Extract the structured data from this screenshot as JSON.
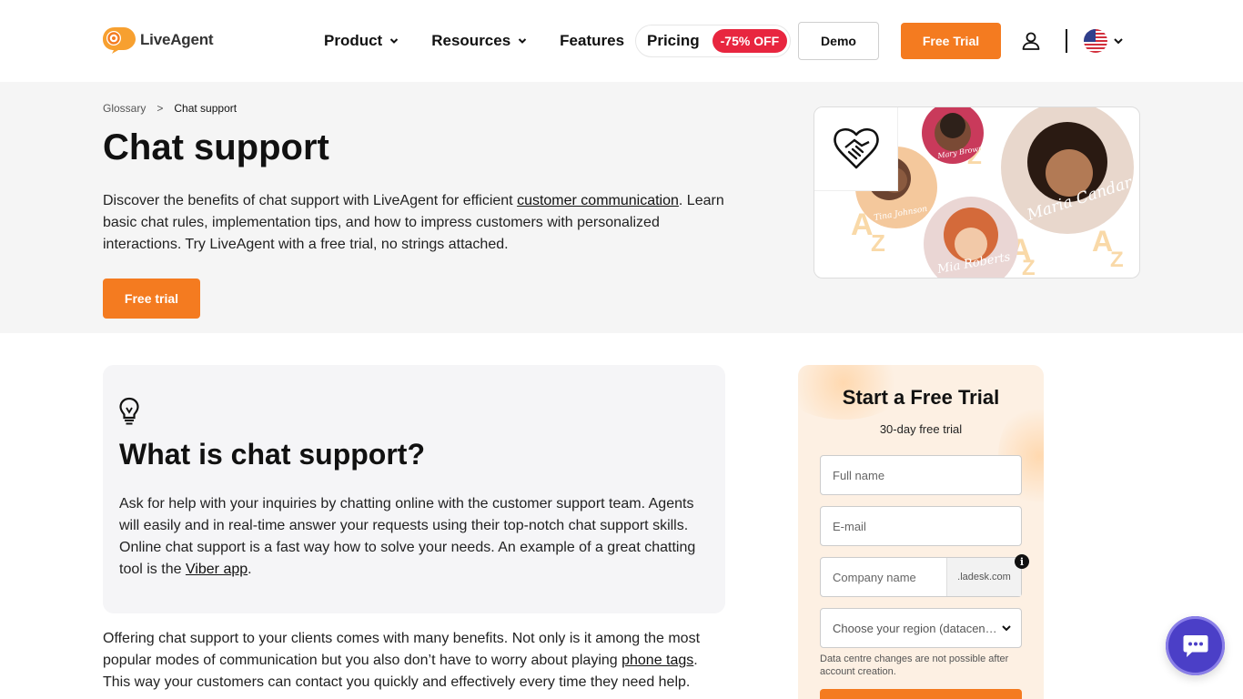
{
  "header": {
    "logo_text": "LiveAgent",
    "nav": [
      {
        "label": "Product",
        "has_dropdown": true
      },
      {
        "label": "Resources",
        "has_dropdown": true
      },
      {
        "label": "Features",
        "has_dropdown": false
      }
    ],
    "pricing_label": "Pricing",
    "pricing_badge": "-75% OFF",
    "demo_label": "Demo",
    "free_trial_label": "Free Trial",
    "user_icon": "user-icon",
    "language_flag": "us-flag-icon"
  },
  "breadcrumb": {
    "parent": "Glossary",
    "separator": ">",
    "current": "Chat support"
  },
  "hero": {
    "title": "Chat support",
    "desc_1": "Discover the benefits of chat support with LiveAgent for efficient ",
    "desc_link": "customer communication",
    "desc_2": ". Learn basic chat rules, implementation tips, and how to impress customers with personalized interactions. Try LiveAgent with a free trial, no strings attached.",
    "cta": "Free trial",
    "art_names": [
      "Mary Brown",
      "Tina Johnson",
      "Maria Candar",
      "Mia Roberts"
    ]
  },
  "card": {
    "icon": "lightbulb-icon",
    "title": "What is chat support?",
    "text_1": "Ask for help with your inquiries by chatting online with the customer support team. Agents will easily and in real-time answer your requests using their top-notch chat support skills. Online chat support is a fast way how to solve your needs. An example of a great chatting tool is the ",
    "text_link": "Viber app",
    "text_2": "."
  },
  "body": {
    "text_1": "Offering chat support to your clients comes with many benefits. Not only is it among the most popular modes of communication but you also don’t have to worry about playing ",
    "text_link": "phone tags",
    "text_2": ". This way your customers can contact you quickly and effectively every time they need help."
  },
  "signup": {
    "title": "Start a Free Trial",
    "subtitle": "30-day free trial",
    "full_name_placeholder": "Full name",
    "email_placeholder": "E-mail",
    "company_placeholder": "Company name",
    "domain_suffix": ".ladesk.com",
    "region_placeholder": "Choose your region (datacen…",
    "note": "Data centre changes are not possible after account creation."
  },
  "colors": {
    "brand_orange": "#f47b20",
    "badge_red": "#e8263f",
    "chat_purple": "#4b3fc7"
  }
}
